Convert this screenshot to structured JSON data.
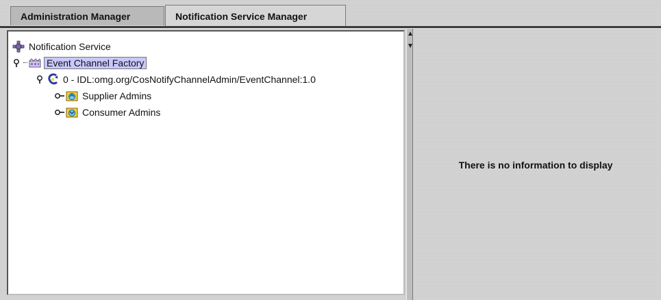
{
  "tabs": [
    {
      "label": "Administration Manager",
      "active": false
    },
    {
      "label": "Notification Service Manager",
      "active": true
    }
  ],
  "tree": {
    "root": "Notification Service",
    "factory": "Event Channel Factory",
    "channel": "0 - IDL:omg.org/CosNotifyChannelAdmin/EventChannel:1.0",
    "supplier": "Supplier Admins",
    "consumer": "Consumer Admins",
    "selected": "Event Channel Factory"
  },
  "detail": {
    "message": "There is no information to display"
  },
  "colors": {
    "selection": "#c8c8ff",
    "background": "#cdcdcd"
  }
}
